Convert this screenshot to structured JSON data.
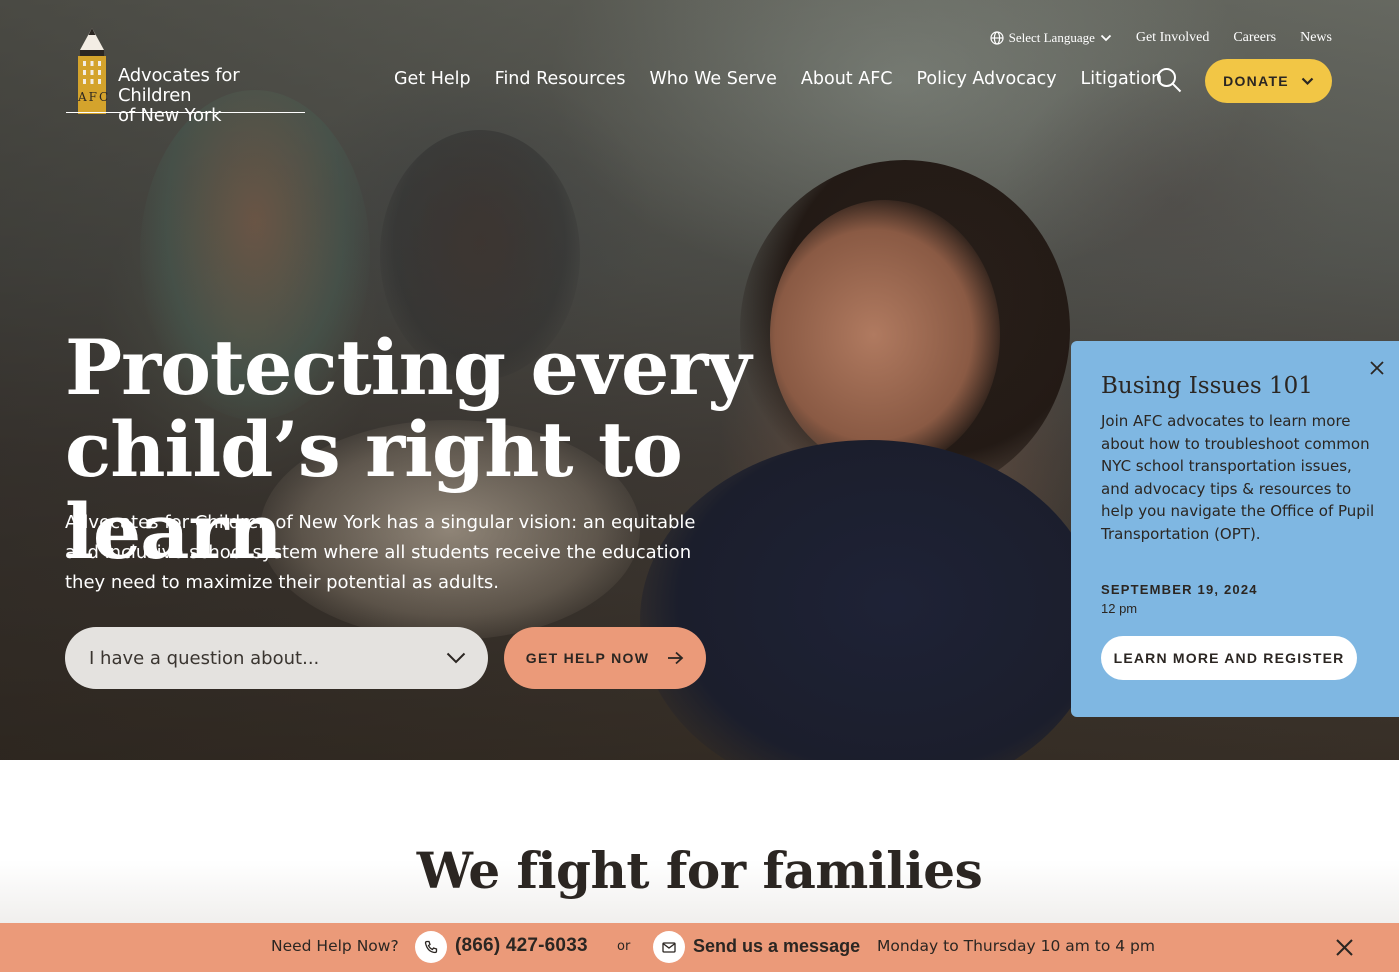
{
  "brand": {
    "logo_mark": "AFC",
    "name_line1": "Advocates for Children",
    "name_line2": "of New York"
  },
  "utility_nav": {
    "language_label": "Select Language",
    "items": [
      "Get Involved",
      "Careers",
      "News"
    ]
  },
  "main_nav": {
    "items": [
      "Get Help",
      "Find Resources",
      "Who We Serve",
      "About AFC",
      "Policy Advocacy",
      "Litigation"
    ],
    "donate_label": "DONATE"
  },
  "hero": {
    "title_line1": "Protecting every",
    "title_line2": "child’s right to learn",
    "body": "Advocates for Children of New York has a singular vision: an equitable and inclusive school system where all students receive the education they need to maximize their potential as adults.",
    "question_placeholder": "I have a question about...",
    "cta_label": "GET HELP NOW"
  },
  "event_card": {
    "title": "Busing Issues 101",
    "description": "Join AFC advocates to learn more about how to troubleshoot common NYC school transportation issues, and advocacy tips & resources to help you navigate the Office of Pupil Transportation (OPT).",
    "date": "SEPTEMBER 19, 2024",
    "time": "12 pm",
    "button_label": "LEARN MORE AND REGISTER"
  },
  "section": {
    "title": "We fight for families"
  },
  "help_bar": {
    "label": "Need Help Now?",
    "phone": "(866) 427-6033",
    "or": "or",
    "message_label": "Send us a message",
    "hours": "Monday to Thursday 10 am to 4 pm"
  },
  "colors": {
    "donate": "#f2c645",
    "accent_salmon": "#eb9a79",
    "event_blue": "#7fb7e2",
    "text_dark": "#2b2622"
  },
  "icons": [
    "globe-icon",
    "chevron-down-icon",
    "search-icon",
    "arrow-right-icon",
    "close-icon",
    "phone-icon",
    "mail-icon"
  ]
}
